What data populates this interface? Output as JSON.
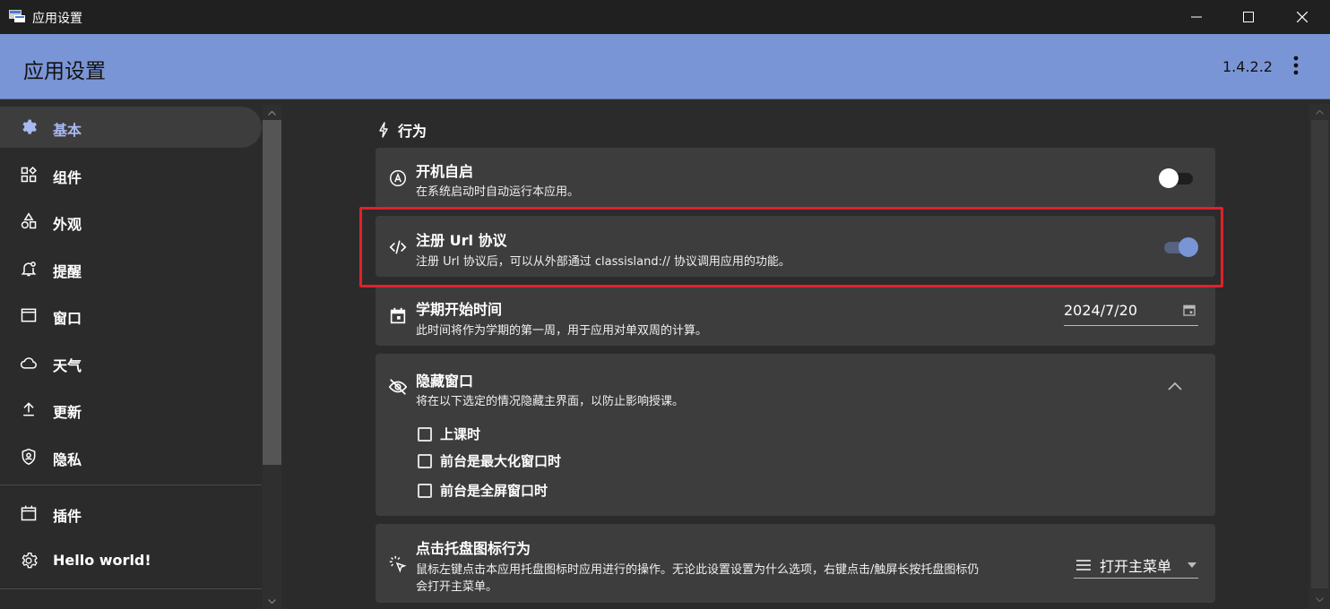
{
  "window": {
    "title": "应用设置",
    "minimize_icon": "minimize-icon",
    "maximize_icon": "maximize-icon",
    "close_icon": "close-icon"
  },
  "header": {
    "title": "应用设置",
    "version": "1.4.2.2",
    "more_icon": "more-vert-icon",
    "background": "#7a95d6"
  },
  "sidebar": {
    "items": [
      {
        "label": "基本",
        "icon": "gear-icon",
        "selected": true
      },
      {
        "label": "组件",
        "icon": "widgets-icon"
      },
      {
        "label": "外观",
        "icon": "shapes-icon"
      },
      {
        "label": "提醒",
        "icon": "bell-icon"
      },
      {
        "label": "窗口",
        "icon": "window-icon"
      },
      {
        "label": "天气",
        "icon": "cloud-icon"
      },
      {
        "label": "更新",
        "icon": "upload-icon"
      },
      {
        "label": "隐私",
        "icon": "shield-icon"
      }
    ],
    "bottom_items": [
      {
        "label": "插件",
        "icon": "calendar-icon"
      },
      {
        "label": "Hello world!",
        "icon": "gear-icon"
      }
    ],
    "selected_color": "#a8b8f0"
  },
  "main": {
    "section": {
      "title": "行为",
      "icon": "bolt-icon"
    },
    "cards": {
      "autostart": {
        "title": "开机自启",
        "description": "在系统启动时自动运行本应用。",
        "icon": "auto-start-icon",
        "enabled": false
      },
      "url_protocol": {
        "title": "注册 Url 协议",
        "description": "注册 Url 协议后，可以从外部通过 classisland:// 协议调用应用的功能。",
        "icon": "code-icon",
        "enabled": true,
        "highlighted": true
      },
      "semester": {
        "title": "学期开始时间",
        "description": "此时间将作为学期的第一周，用于应用对单双周的计算。",
        "icon": "calendar-icon",
        "date_value": "2024/7/20"
      },
      "hide_window": {
        "title": "隐藏窗口",
        "description": "将在以下选定的情况隐藏主界面，以防止影响授课。",
        "icon": "eye-off-icon",
        "expanded": true,
        "options": [
          {
            "label": "上课时",
            "checked": false
          },
          {
            "label": "前台是最大化窗口时",
            "checked": false
          },
          {
            "label": "前台是全屏窗口时",
            "checked": false
          }
        ]
      },
      "tray": {
        "title": "点击托盘图标行为",
        "description_line1": "鼠标左键点击本应用托盘图标时应用进行的操作。无论此设置设置为什么选项，右键点击/触屏长按托盘图标仍",
        "description_line2": "会打开主菜单。",
        "icon": "click-icon",
        "selected": "打开主菜单"
      }
    }
  },
  "colors": {
    "accent": "#7a95d6",
    "toggle_on": "#7a95d6",
    "highlight_border": "#e0212a",
    "card_bg": "#3d3d3d",
    "page_bg": "#2b2b2b"
  }
}
